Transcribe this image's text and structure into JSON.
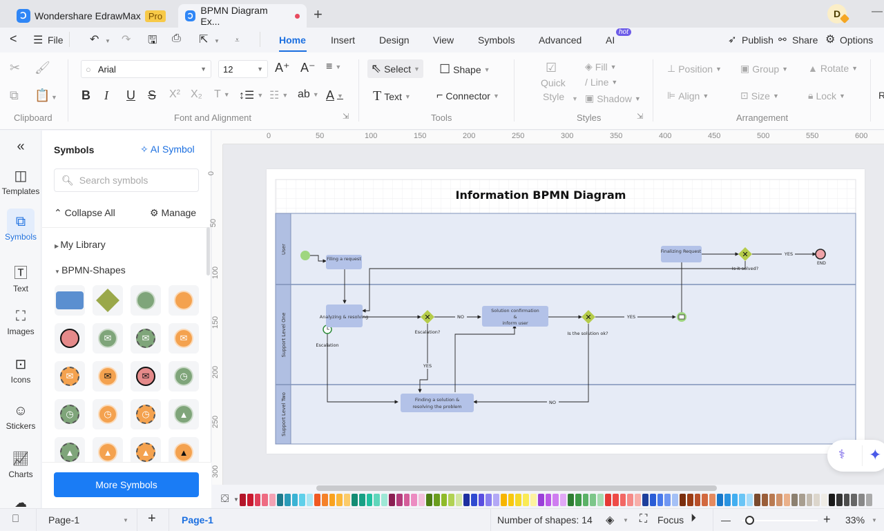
{
  "titlebar": {
    "app_name": "Wondershare EdrawMax",
    "pro_badge": "Pro",
    "doc_tab": "BPMN Diagram Ex...",
    "new_tab": "+",
    "avatar_initial": "D",
    "minimize": "—"
  },
  "menubar": {
    "back": "<",
    "file": "File",
    "tabs": [
      "Home",
      "Insert",
      "Design",
      "View",
      "Symbols",
      "Advanced",
      "AI"
    ],
    "active_tab": "Home",
    "hot_badge": "hot",
    "publish": "Publish",
    "share": "Share",
    "options": "Options"
  },
  "ribbon": {
    "clipboard_label": "Clipboard",
    "font_label": "Font and Alignment",
    "tools_label": "Tools",
    "styles_label": "Styles",
    "arrangement_label": "Arrangement",
    "font_family": "Arial",
    "font_size": "12",
    "select": "Select",
    "shape": "Shape",
    "text": "Text",
    "connector": "Connector",
    "quick_style_1": "Quick",
    "quick_style_2": "Style",
    "fill": "Fill",
    "line": "Line",
    "shadow": "Shadow",
    "position": "Position",
    "group": "Group",
    "rotate": "Rotate",
    "align": "Align",
    "size": "Size",
    "lock": "Lock",
    "cut_off": "R"
  },
  "rail": {
    "items": [
      {
        "label": "Templates",
        "icon": "templates-icon"
      },
      {
        "label": "Symbols",
        "icon": "symbols-icon"
      },
      {
        "label": "Text",
        "icon": "text-icon"
      },
      {
        "label": "Images",
        "icon": "images-icon"
      },
      {
        "label": "Icons",
        "icon": "icons-icon"
      },
      {
        "label": "Stickers",
        "icon": "stickers-icon"
      },
      {
        "label": "Charts",
        "icon": "charts-icon"
      }
    ],
    "active": "Symbols"
  },
  "panel": {
    "title": "Symbols",
    "ai_symbol": "AI Symbol",
    "search_placeholder": "Search symbols",
    "collapse_all": "Collapse All",
    "manage": "Manage",
    "my_library": "My Library",
    "bpmn_shapes": "BPMN-Shapes",
    "more_symbols": "More Symbols"
  },
  "rulers": {
    "horizontal": [
      "0",
      "50",
      "100",
      "150",
      "200",
      "250",
      "300",
      "350",
      "400",
      "450",
      "500",
      "550",
      "600"
    ],
    "vertical": [
      "0",
      "50",
      "100",
      "150",
      "200",
      "250",
      "300"
    ]
  },
  "diagram": {
    "title": "Information BPMN Diagram",
    "lanes": [
      "User",
      "Support Level One",
      "Support Level Two"
    ],
    "tasks": {
      "filing": "Filing a request",
      "finalizing": "Finalizing Request",
      "analyzing": "Analyzing & resolving",
      "confirmation_1": "Solution confirmation",
      "confirmation_2": "&",
      "confirmation_3": "inform user",
      "finding_1": "Finding a solution &",
      "finding_2": "resolving the problem"
    },
    "labels": {
      "end": "END",
      "is_it_solved": "Is it solved?",
      "escalation_q": "Escalation?",
      "escalation": "Escalation",
      "solution_ok": "Is the solution ok?",
      "yes": "YES",
      "no": "NO"
    },
    "colors": {
      "lane_fill": "#e6ebf6",
      "lane_header": "#b0bfe2",
      "task_fill": "#b3c2e8",
      "gateway": "#b5cc4a",
      "start": "#9fd67f",
      "end": "#f0a3a8"
    }
  },
  "palette": {
    "colors": [
      "#b3162a",
      "#c8192f",
      "#e0405a",
      "#ee6b82",
      "#f3a3b4",
      "#1f7a8c",
      "#2b9bb8",
      "#3bb3d4",
      "#5fd0ea",
      "#a8e6f3",
      "#f05a22",
      "#f5822a",
      "#f9a21f",
      "#fbb73a",
      "#fbcb6a",
      "#138c74",
      "#17a085",
      "#22c0a0",
      "#5fd6bb",
      "#9ee8d6",
      "#8a1f52",
      "#b33b7a",
      "#d45d99",
      "#ec8cc2",
      "#f3c0dc",
      "#4e7e15",
      "#6a9d1e",
      "#8fba2a",
      "#b1d254",
      "#d2e6a0",
      "#1d2fa0",
      "#2f4ad0",
      "#5a4ee0",
      "#8a7ef0",
      "#b3a8f6",
      "#f7b500",
      "#f9c80e",
      "#f5d92a",
      "#faea54",
      "#fdf3a0",
      "#9a3fd8",
      "#bb59e8",
      "#cf7df0",
      "#e1a8f6",
      "#2e7d32",
      "#3f9a48",
      "#5bb267",
      "#7dc68a",
      "#a6dbb0",
      "#e53935",
      "#ee4b48",
      "#f26865",
      "#f58b88",
      "#f8aea9",
      "#1e3f9c",
      "#2a5cd6",
      "#4979ea",
      "#6f96f2",
      "#a4c0f6",
      "#7a2e0e",
      "#9a3c15",
      "#b8502a",
      "#d2683f",
      "#e58a5f",
      "#1877c9",
      "#2a93e0",
      "#42aef0",
      "#6ac5f6",
      "#a6dcfa",
      "#7a4a2e",
      "#9a5e3a",
      "#b97a52",
      "#d0926a",
      "#eab08a",
      "#8c8070",
      "#a89e90",
      "#c4bcb0",
      "#dcd6cc",
      "#efece6",
      "#1a1a1a",
      "#333333",
      "#4d4d4d",
      "#666666",
      "#888888",
      "#aaaaaa"
    ]
  },
  "statusbar": {
    "page_select": "Page-1",
    "add_page": "+",
    "active_page": "Page-1",
    "shape_count": "Number of shapes: 14",
    "focus": "Focus",
    "zoom_minus": "—",
    "zoom_plus": "+",
    "zoom_level": "33%",
    "zoom_fraction": 0.1
  }
}
